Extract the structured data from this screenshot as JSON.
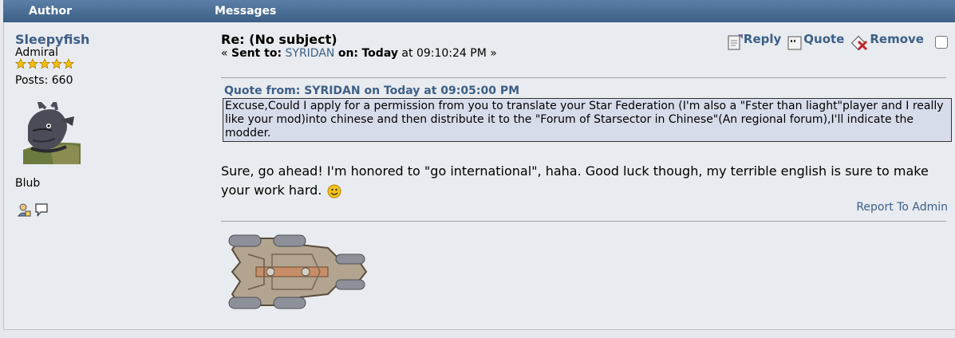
{
  "header": {
    "author_label": "Author",
    "messages_label": "Messages"
  },
  "author": {
    "name": "Sleepyfish",
    "rank": "Admiral",
    "stars": 5,
    "posts": "Posts: 660",
    "personal_text": "Blub"
  },
  "post": {
    "subject": "Re: (No subject)",
    "sent_prefix": "« ",
    "sent_to_label": "Sent to:",
    "sent_to_user": "SYRIDAN",
    "on_label": "on:",
    "on_day": "Today",
    "at_time": "at 09:10:24 PM »",
    "actions": {
      "reply": "Reply",
      "quote": "Quote",
      "remove": "Remove"
    },
    "quote_header": "Quote from: SYRIDAN on Today at 09:05:00 PM",
    "quote_text": "Excuse,Could I apply for a permission from you to translate your Star Federation (I'm also a \"Fster than liaght\"player and I really like your mod)into chinese and then distribute it to the \"Forum of Starsector in Chinese\"(An regional forum),I'll indicate the modder.",
    "body": "Sure, go ahead! I'm honored to \"go international\", haha. Good luck though, my terrible english is sure to make your work hard.",
    "report": "Report To Admin"
  },
  "colors": {
    "header": "#4a6d96",
    "link": "#3d5f86",
    "quote_bg": "#d7dceb",
    "panel": "#e8ebef"
  }
}
